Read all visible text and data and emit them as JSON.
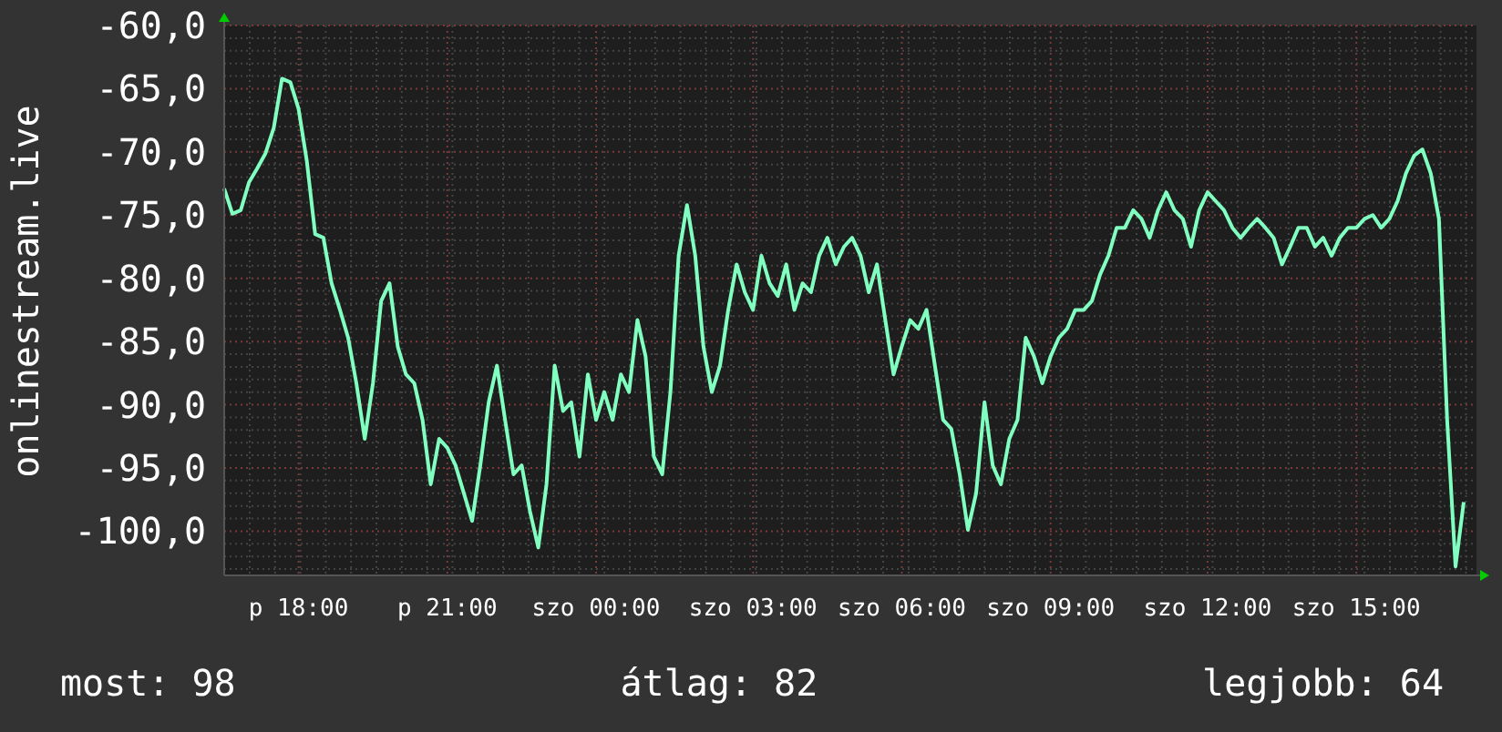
{
  "chart": {
    "chart_data": {
      "type": "line",
      "ylabel": "onlinestream.live",
      "grid": true,
      "ylim": [
        -103.5,
        -60
      ],
      "categories": [
        null,
        null,
        null,
        null,
        null,
        null,
        null,
        null,
        null,
        "p 18:00",
        null,
        null,
        null,
        null,
        null,
        null,
        null,
        null,
        null,
        null,
        null,
        null,
        null,
        null,
        null,
        null,
        null,
        "p 21:00",
        null,
        null,
        null,
        null,
        null,
        null,
        null,
        null,
        null,
        null,
        null,
        null,
        null,
        null,
        null,
        null,
        null,
        "szo 00:00",
        null,
        null,
        null,
        null,
        null,
        null,
        null,
        null,
        null,
        null,
        null,
        null,
        null,
        null,
        null,
        null,
        null,
        null,
        "szo 03:00",
        null,
        null,
        null,
        null,
        null,
        null,
        null,
        null,
        null,
        null,
        null,
        null,
        null,
        null,
        null,
        null,
        null,
        "szo 06:00",
        null,
        null,
        null,
        null,
        null,
        null,
        null,
        null,
        null,
        null,
        null,
        null,
        null,
        null,
        null,
        null,
        null,
        "szo 09:00",
        null,
        null,
        null,
        null,
        null,
        null,
        null,
        null,
        null,
        null,
        null,
        null,
        null,
        null,
        null,
        null,
        null,
        null,
        "szo 12:00",
        null,
        null,
        null,
        null,
        null,
        null,
        null,
        null,
        null,
        null,
        null,
        null,
        null,
        null,
        null,
        null,
        null,
        "szo 15:00",
        null,
        null,
        null,
        null,
        null,
        null,
        null,
        null,
        null,
        null,
        null,
        null,
        null
      ],
      "yticks": [
        {
          "value": -60,
          "label": "-60,0"
        },
        {
          "value": -65,
          "label": "-65,0"
        },
        {
          "value": -70,
          "label": "-70,0"
        },
        {
          "value": -75,
          "label": "-75,0"
        },
        {
          "value": -80,
          "label": "-80,0"
        },
        {
          "value": -85,
          "label": "-85,0"
        },
        {
          "value": -90,
          "label": "-90,0"
        },
        {
          "value": -95,
          "label": "-95,0"
        },
        {
          "value": -100,
          "label": "-100,0"
        }
      ],
      "series": [
        {
          "color": "#80ffc0",
          "values": [
            -72.9,
            -74.9,
            -74.6,
            -72.4,
            -71.3,
            -70.1,
            -68.1,
            -64.2,
            -64.5,
            -66.6,
            -70.7,
            -76.5,
            -76.8,
            -80.4,
            -82.5,
            -84.7,
            -88.3,
            -92.7,
            -88.3,
            -81.8,
            -80.4,
            -85.4,
            -87.6,
            -88.3,
            -91.2,
            -96.3,
            -92.7,
            -93.4,
            -94.8,
            -97.0,
            -99.2,
            -94.8,
            -89.8,
            -86.9,
            -91.2,
            -95.5,
            -94.8,
            -98.4,
            -101.3,
            -96.3,
            -86.9,
            -90.5,
            -89.8,
            -94.1,
            -87.6,
            -91.2,
            -89.0,
            -91.2,
            -87.6,
            -89.0,
            -83.3,
            -86.2,
            -94.1,
            -95.5,
            -89.0,
            -78.2,
            -74.2,
            -78.2,
            -85.4,
            -89.0,
            -86.9,
            -82.5,
            -78.9,
            -81.1,
            -82.5,
            -78.2,
            -80.4,
            -81.4,
            -78.9,
            -82.5,
            -80.4,
            -81.1,
            -78.2,
            -76.8,
            -78.9,
            -77.5,
            -76.8,
            -78.2,
            -81.1,
            -78.9,
            -83.3,
            -87.6,
            -85.4,
            -83.3,
            -84.0,
            -82.5,
            -86.9,
            -91.2,
            -91.9,
            -95.5,
            -99.9,
            -97.0,
            -89.8,
            -94.8,
            -96.3,
            -92.7,
            -91.2,
            -84.7,
            -86.2,
            -88.3,
            -86.2,
            -84.7,
            -84.0,
            -82.5,
            -82.5,
            -81.8,
            -79.7,
            -78.2,
            -76.0,
            -76.0,
            -74.6,
            -75.3,
            -76.8,
            -74.6,
            -73.2,
            -74.6,
            -75.3,
            -77.5,
            -74.6,
            -73.2,
            -73.9,
            -74.6,
            -76.0,
            -76.8,
            -76.0,
            -75.3,
            -76.0,
            -76.8,
            -78.9,
            -77.5,
            -76.0,
            -76.0,
            -77.5,
            -76.8,
            -78.2,
            -76.8,
            -76.0,
            -76.0,
            -75.3,
            -75.0,
            -76.0,
            -75.3,
            -73.9,
            -71.7,
            -70.3,
            -69.8,
            -71.7,
            -75.3,
            -91.2,
            -102.8,
            -97.7
          ]
        }
      ]
    }
  },
  "footer": {
    "current": "most: 98",
    "average": "átlag: 82",
    "best": "legjobb: 64"
  }
}
